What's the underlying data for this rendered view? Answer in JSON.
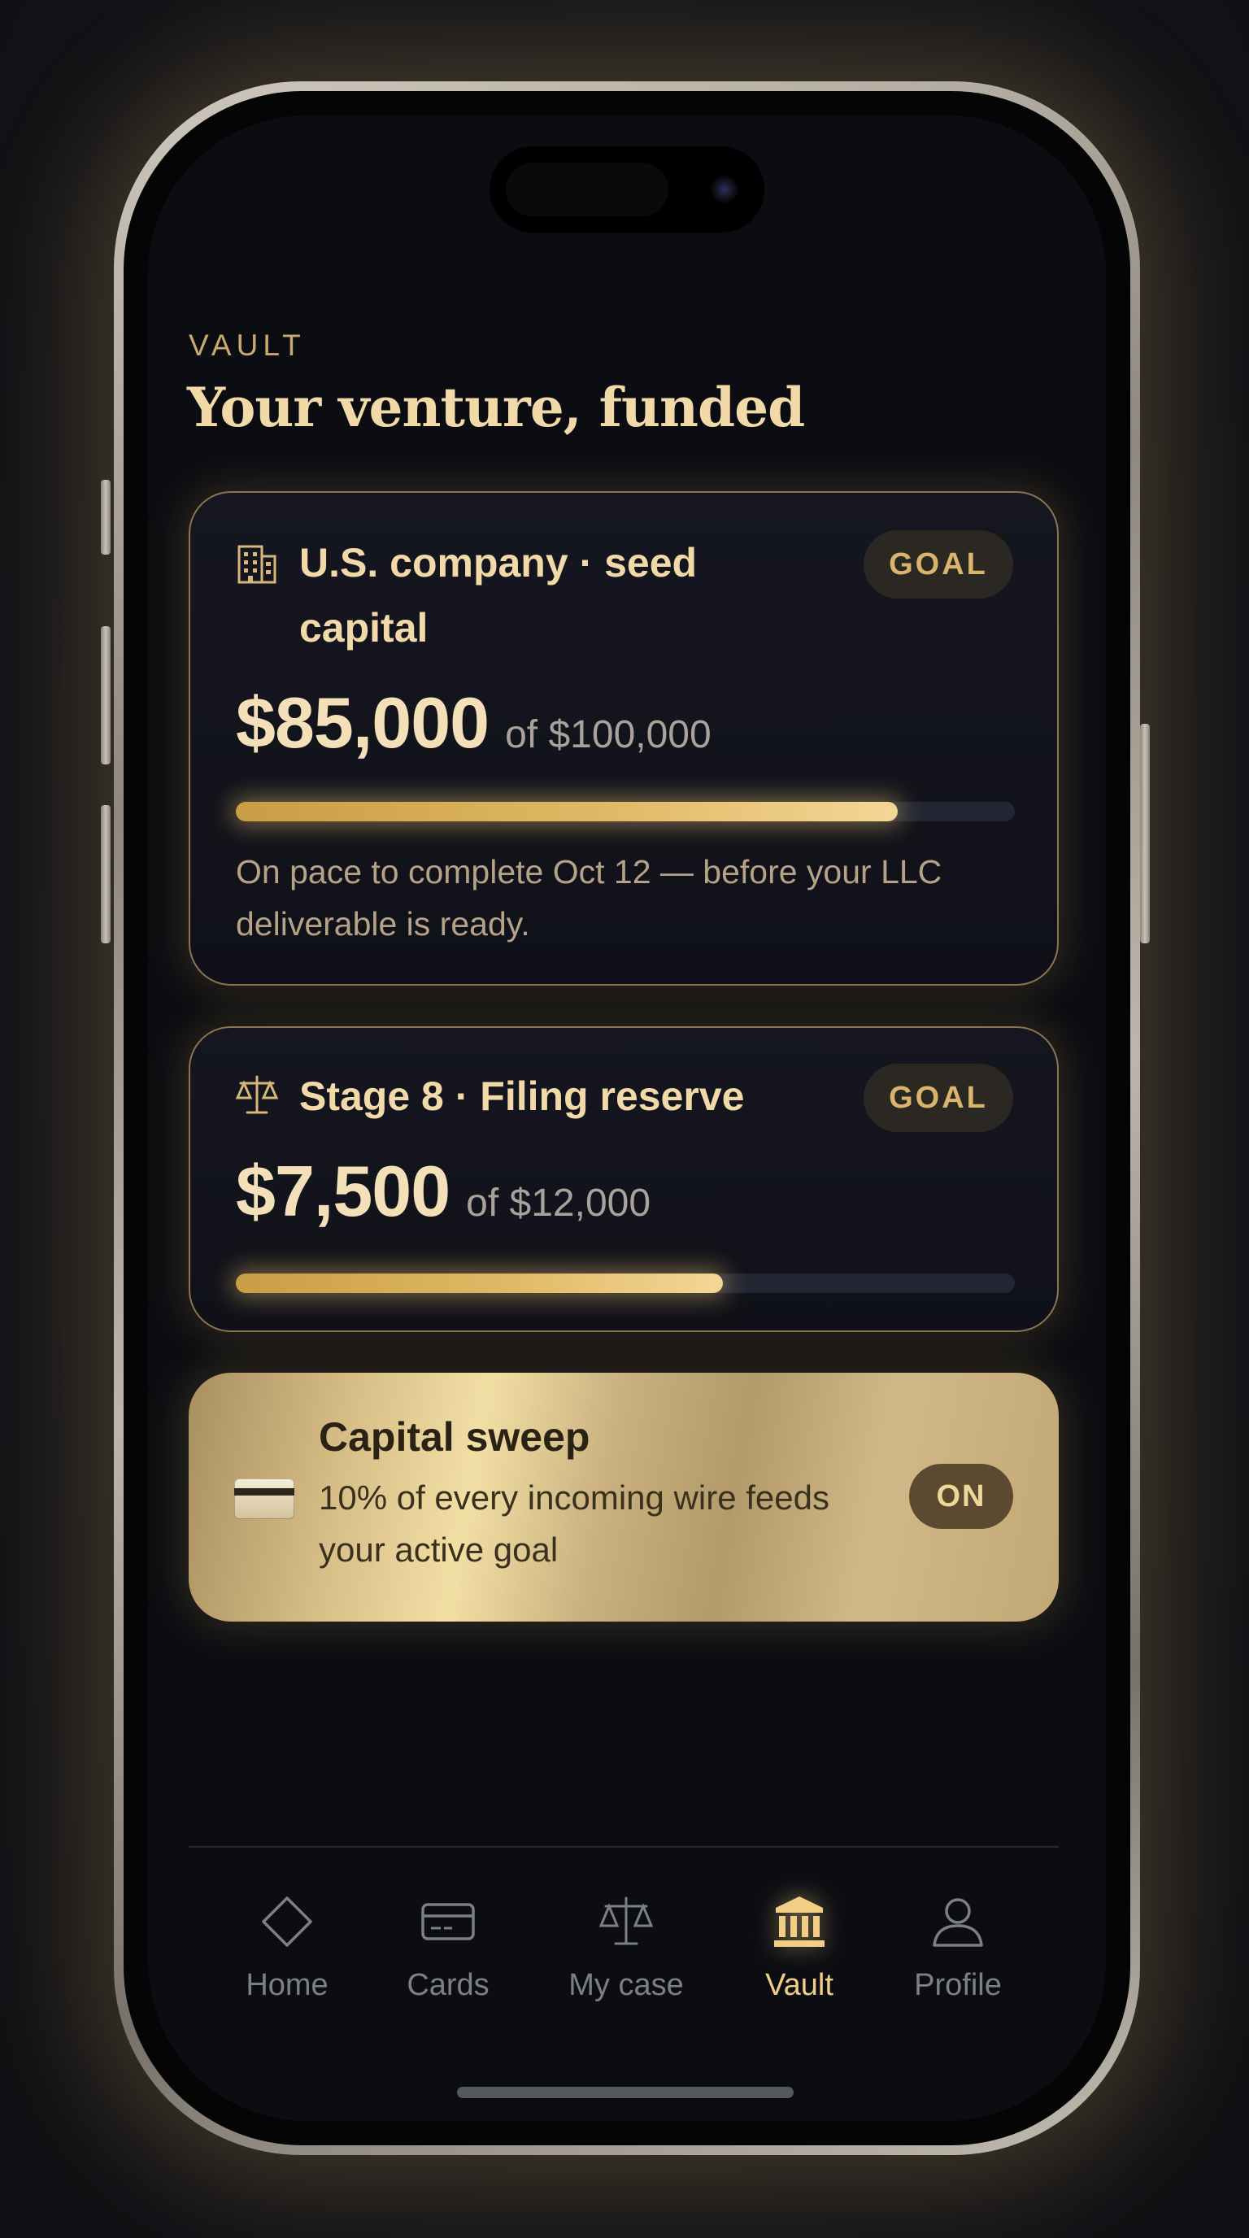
{
  "header": {
    "eyebrow": "VAULT",
    "title": "Your venture, funded"
  },
  "goals": [
    {
      "icon": "building-icon",
      "title": "U.S. company · seed capital",
      "badge": "GOAL",
      "amount": "$85,000",
      "target": "of $100,000",
      "progress": 0.85,
      "note": "On pace to complete Oct 12 — before your LLC deliverable is ready."
    },
    {
      "icon": "scales-icon",
      "title": "Stage 8 · Filing reserve",
      "badge": "GOAL",
      "amount": "$7,500",
      "target": "of $12,000",
      "progress": 0.625
    }
  ],
  "sweep": {
    "icon": "credit-card-icon",
    "title": "Capital sweep",
    "description": "10% of every incoming wire feeds your active goal",
    "toggle": "ON"
  },
  "tabbar": {
    "items": [
      {
        "label": "Home",
        "icon": "diamond-icon",
        "active": false
      },
      {
        "label": "Cards",
        "icon": "card-icon",
        "active": false
      },
      {
        "label": "My case",
        "icon": "scales-icon",
        "active": false
      },
      {
        "label": "Vault",
        "icon": "bank-icon",
        "active": true
      },
      {
        "label": "Profile",
        "icon": "person-icon",
        "active": false
      }
    ]
  },
  "colors": {
    "accent_gold": "#f0cf85",
    "background": "#0c0d12",
    "muted": "#7d7f88"
  }
}
